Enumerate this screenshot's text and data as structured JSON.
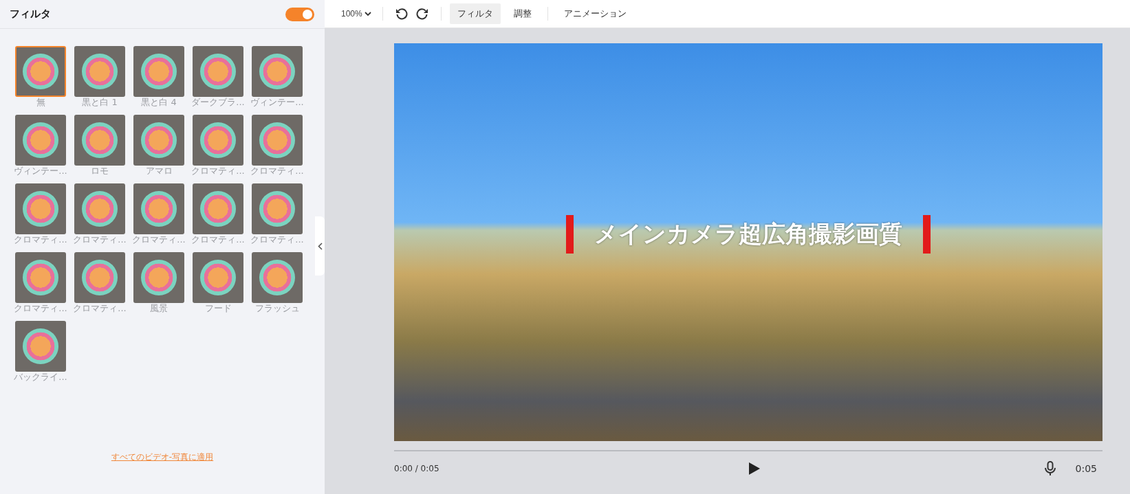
{
  "filter_panel": {
    "title": "フィルタ",
    "toggle": {
      "on": true
    },
    "filters": [
      {
        "label": "無",
        "selected": true
      },
      {
        "label": "黒と白 1",
        "selected": false
      },
      {
        "label": "黒と白 4",
        "selected": false
      },
      {
        "label": "ダークブラ...",
        "selected": false
      },
      {
        "label": "ヴィンテー...",
        "selected": false
      },
      {
        "label": "ヴィンテー...",
        "selected": false
      },
      {
        "label": "ロモ",
        "selected": false
      },
      {
        "label": "アマロ",
        "selected": false
      },
      {
        "label": "クロマティ...",
        "selected": false
      },
      {
        "label": "クロマティ...",
        "selected": false
      },
      {
        "label": "クロマティ...",
        "selected": false
      },
      {
        "label": "クロマティ...",
        "selected": false
      },
      {
        "label": "クロマティ...",
        "selected": false
      },
      {
        "label": "クロマティ...",
        "selected": false
      },
      {
        "label": "クロマティ...",
        "selected": false
      },
      {
        "label": "クロマティ...",
        "selected": false
      },
      {
        "label": "クロマティ...",
        "selected": false
      },
      {
        "label": "風景",
        "selected": false
      },
      {
        "label": "フード",
        "selected": false
      },
      {
        "label": "フラッシュ",
        "selected": false
      },
      {
        "label": "バックライ...",
        "selected": false
      }
    ],
    "apply_link": "すべてのビデオ-写真に適用"
  },
  "toolbar": {
    "zoom": "100%",
    "tabs": [
      {
        "label": "フィルタ",
        "selected": true
      },
      {
        "label": "調整",
        "selected": false
      },
      {
        "label": "アニメーション",
        "selected": false
      }
    ]
  },
  "player": {
    "caption": "メインカメラ超広角撮影画質",
    "current_time": "0:00 / 0:05",
    "duration": "0:05"
  }
}
